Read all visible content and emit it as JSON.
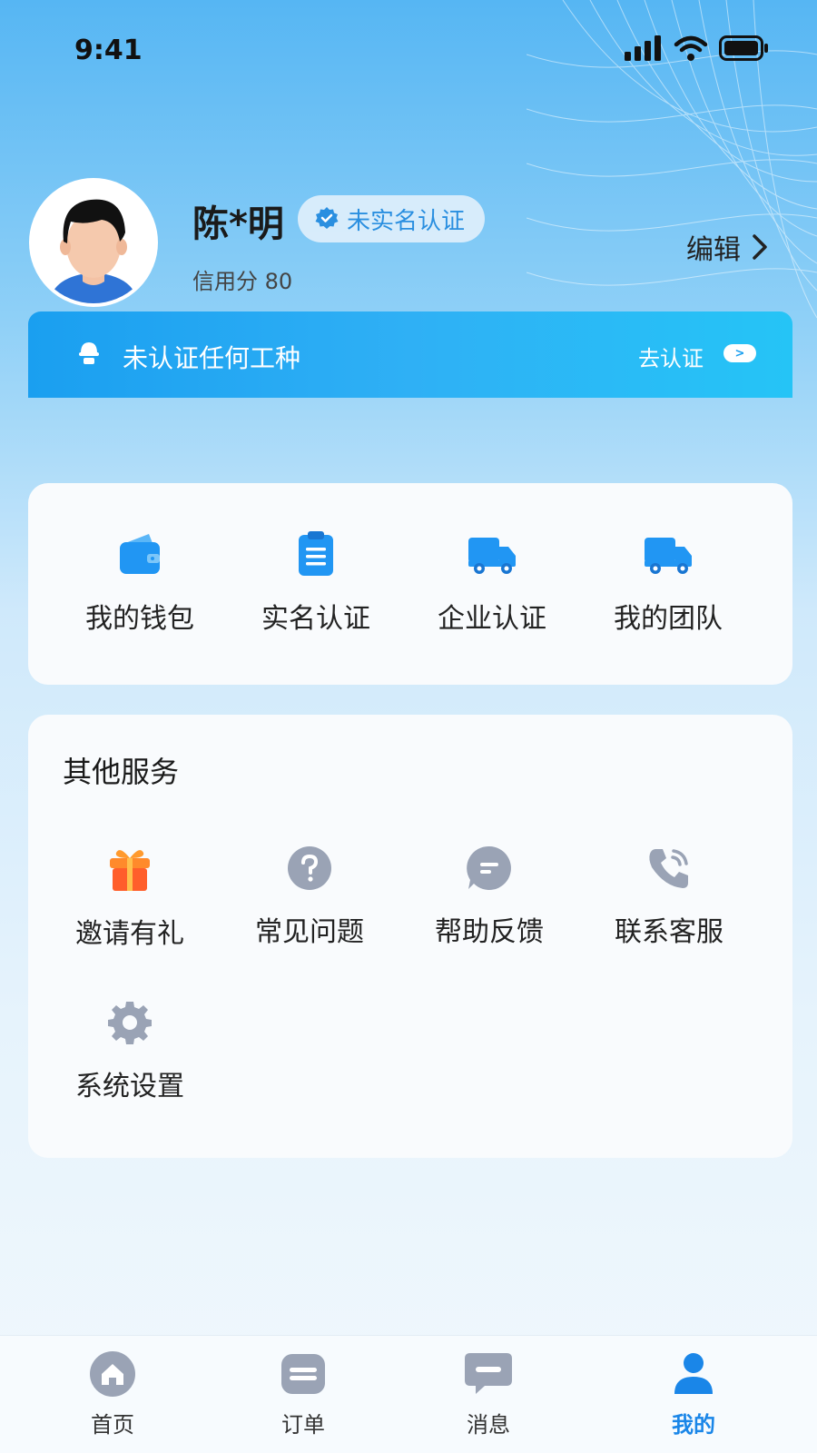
{
  "status_bar": {
    "time": "9:41"
  },
  "profile": {
    "name": "陈*明",
    "verify_badge": "未实名认证",
    "credit_label": "信用分 80",
    "edit_label": "编辑"
  },
  "banner": {
    "text": "未认证任何工种",
    "action": "去认证",
    "eye_glyph": ">"
  },
  "quick_actions": [
    {
      "label": "我的钱包",
      "icon": "wallet-icon"
    },
    {
      "label": "实名认证",
      "icon": "clipboard-icon"
    },
    {
      "label": "企业认证",
      "icon": "truck-icon"
    },
    {
      "label": "我的团队",
      "icon": "truck-icon"
    }
  ],
  "services": {
    "title": "其他服务",
    "items": [
      {
        "label": "邀请有礼",
        "icon": "gift-icon"
      },
      {
        "label": "常见问题",
        "icon": "question-icon"
      },
      {
        "label": "帮助反馈",
        "icon": "feedback-icon"
      },
      {
        "label": "联系客服",
        "icon": "phone-icon"
      },
      {
        "label": "系统设置",
        "icon": "gear-icon"
      }
    ]
  },
  "tabbar": [
    {
      "label": "首页",
      "icon": "home-icon",
      "active": false
    },
    {
      "label": "订单",
      "icon": "order-icon",
      "active": false
    },
    {
      "label": "消息",
      "icon": "message-icon",
      "active": false
    },
    {
      "label": "我的",
      "icon": "user-icon",
      "active": true
    }
  ],
  "colors": {
    "accent": "#1a86e8",
    "banner": "#1fa6f2",
    "gift": "#ff6a2b",
    "icon_gray": "#9aa3b5"
  }
}
